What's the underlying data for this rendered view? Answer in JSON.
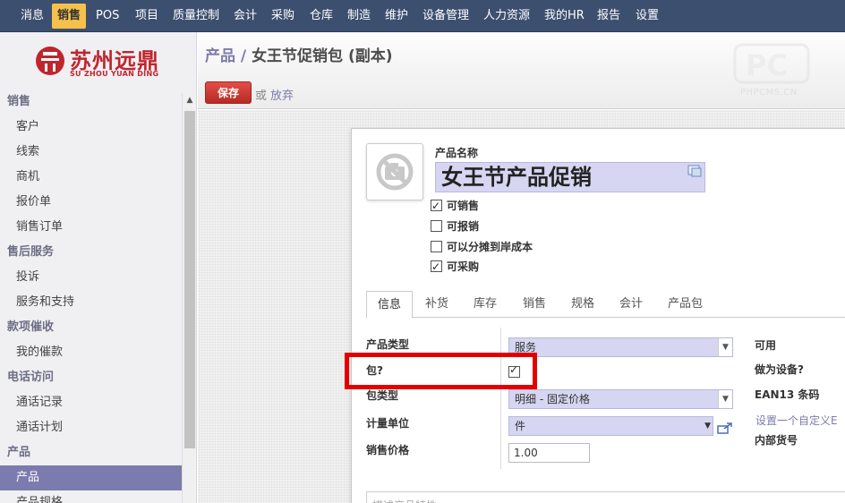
{
  "top_menu": [
    "消息",
    "销售",
    "POS",
    "项目",
    "质量控制",
    "会计",
    "采购",
    "仓库",
    "制造",
    "维护",
    "设备管理",
    "人力资源",
    "我的HR",
    "报告",
    "设置"
  ],
  "active_menu": "销售",
  "logo": {
    "cn": "苏州远鼎",
    "en": "SU ZHOU YUAN DING"
  },
  "sidebar": {
    "sections": [
      {
        "title": "销售",
        "items": [
          "客户",
          "线索",
          "商机",
          "报价单",
          "销售订单"
        ]
      },
      {
        "title": "售后服务",
        "items": [
          "投诉",
          "服务和支持"
        ]
      },
      {
        "title": "款项催收",
        "items": [
          "我的催款"
        ]
      },
      {
        "title": "电话访问",
        "items": [
          "通话记录",
          "通话计划"
        ]
      },
      {
        "title": "产品",
        "items": [
          "产品",
          "产品规格"
        ]
      }
    ],
    "active_item": "产品"
  },
  "header": {
    "breadcrumb_parent": "产品",
    "breadcrumb_sep": "/",
    "breadcrumb_current": "女王节促销包 (副本)",
    "save_label": "保存",
    "or_label": "或",
    "discard_label": "放弃",
    "watermark": "PHPCMS.CN"
  },
  "form": {
    "name_label": "产品名称",
    "name_value": "女王节产品促销",
    "checkboxes": [
      {
        "label": "可销售",
        "checked": true
      },
      {
        "label": "可报销",
        "checked": false
      },
      {
        "label": "可以分摊到岸成本",
        "checked": false
      },
      {
        "label": "可采购",
        "checked": true
      }
    ],
    "tabs": [
      "信息",
      "补货",
      "库存",
      "销售",
      "规格",
      "会计",
      "产品包"
    ],
    "active_tab": "信息",
    "fields": {
      "product_type_label": "产品类型",
      "product_type_value": "服务",
      "package_label": "包?",
      "package_checked": true,
      "package_type_label": "包类型",
      "package_type_value": "明细 - 固定价格",
      "uom_label": "计量单位",
      "uom_value": "件",
      "price_label": "销售价格",
      "price_value": "1.00"
    },
    "right_column": {
      "available_label": "可用",
      "as_device_label": "做为设备?",
      "ean13_label": "EAN13 条码",
      "custom_link": "设置一个自定义E",
      "internal_ref_label": "内部货号"
    },
    "description_placeholder": "描述产品特性..."
  }
}
